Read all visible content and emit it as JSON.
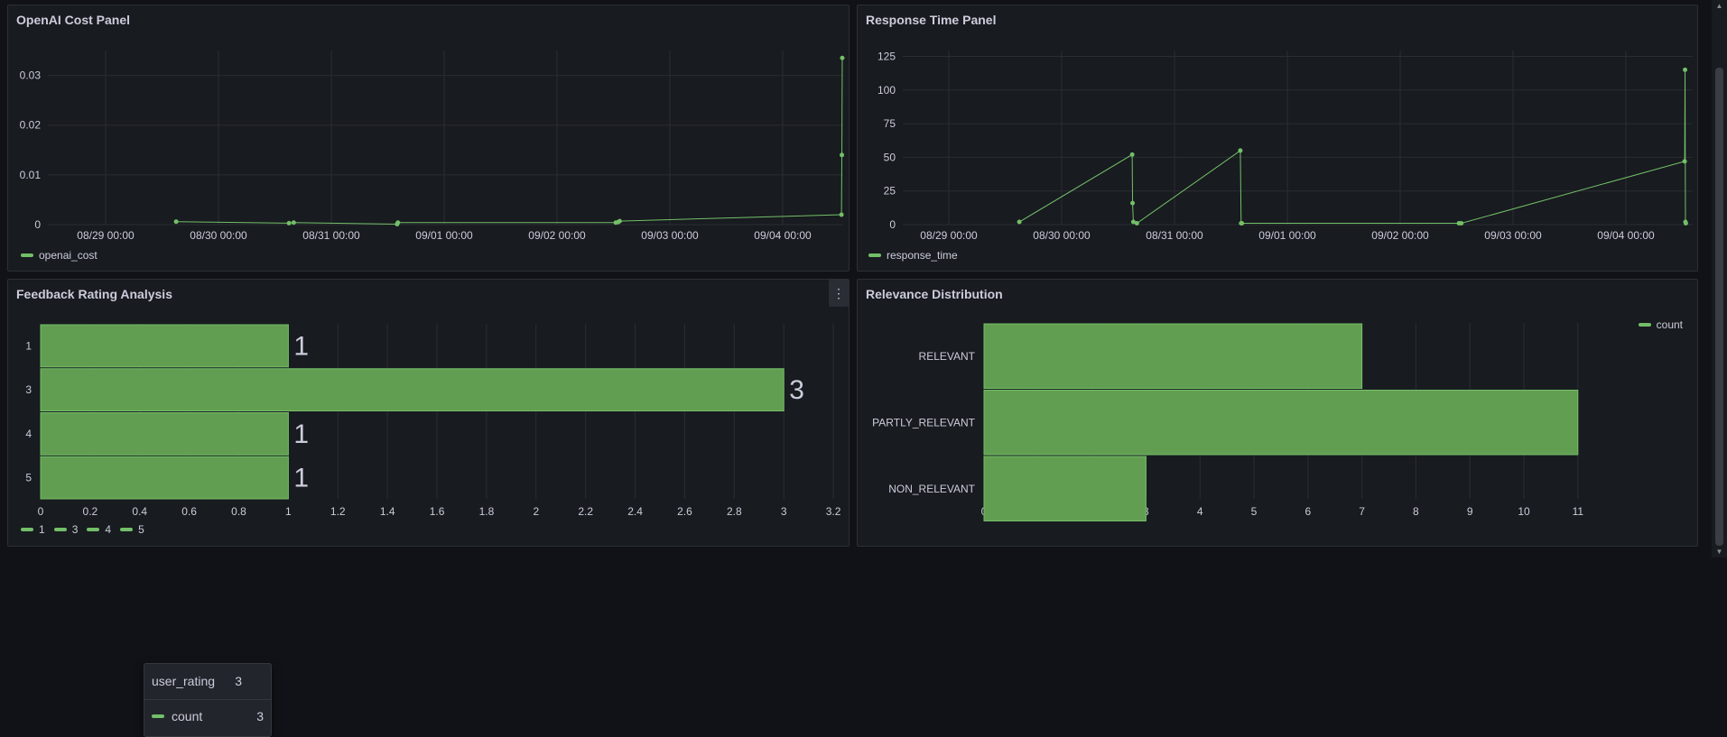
{
  "colors": {
    "series": "#73bf69",
    "bar": "#629e51",
    "bar_edge": "#73bf69"
  },
  "panels": {
    "cost": {
      "title": "OpenAI Cost Panel",
      "legend": [
        "openai_cost"
      ],
      "x_ticks": [
        "08/29 00:00",
        "08/30 00:00",
        "08/31 00:00",
        "09/01 00:00",
        "09/02 00:00",
        "09/03 00:00",
        "09/04 00:00"
      ],
      "y_ticks": [
        "0",
        "0.01",
        "0.02",
        "0.03"
      ]
    },
    "response": {
      "title": "Response Time Panel",
      "legend": [
        "response_time"
      ],
      "x_ticks": [
        "08/29 00:00",
        "08/30 00:00",
        "08/31 00:00",
        "09/01 00:00",
        "09/02 00:00",
        "09/03 00:00",
        "09/04 00:00"
      ],
      "y_ticks": [
        "0",
        "25",
        "50",
        "75",
        "100",
        "125"
      ]
    },
    "feedback": {
      "title": "Feedback Rating Analysis",
      "menu_icon": "⋮",
      "legend": [
        "1",
        "3",
        "4",
        "5"
      ],
      "x_ticks": [
        "0",
        "0.2",
        "0.4",
        "0.6",
        "0.8",
        "1",
        "1.2",
        "1.4",
        "1.6",
        "1.8",
        "2",
        "2.2",
        "2.4",
        "2.6",
        "2.8",
        "3",
        "3.2"
      ],
      "tooltip": {
        "key_label": "user_rating",
        "key_value": "3",
        "series_label": "count",
        "series_value": "3"
      }
    },
    "relevance": {
      "title": "Relevance Distribution",
      "legend": [
        "count"
      ],
      "x_ticks": [
        "0",
        "1",
        "2",
        "3",
        "4",
        "5",
        "6",
        "7",
        "8",
        "9",
        "10",
        "11"
      ]
    }
  },
  "chart_data": [
    {
      "type": "line",
      "title": "OpenAI Cost Panel",
      "series": [
        {
          "name": "openai_cost",
          "x": [
            "08/29 15:00",
            "08/30 15:00",
            "08/30 16:00",
            "08/31 14:00",
            "08/31 14:10",
            "09/02 12:30",
            "09/02 13:00",
            "09/02 13:20",
            "09/04 12:30",
            "09/04 12:35",
            "09/04 12:40"
          ],
          "y": [
            0.0006,
            0.0003,
            0.0004,
            0.0001,
            0.0004,
            0.0004,
            0.0005,
            0.0007,
            0.002,
            0.014,
            0.0335
          ]
        }
      ],
      "ylim": [
        0,
        0.035
      ],
      "legend_position": "bottom-left"
    },
    {
      "type": "line",
      "title": "Response Time Panel",
      "series": [
        {
          "name": "response_time",
          "x": [
            "08/29 15:00",
            "08/30 15:00",
            "08/30 15:05",
            "08/30 15:15",
            "08/30 16:00",
            "08/31 14:00",
            "08/31 14:10",
            "08/31 14:20",
            "09/02 12:30",
            "09/02 13:00",
            "09/04 12:30",
            "09/04 12:35",
            "09/04 12:40",
            "09/04 12:45"
          ],
          "y": [
            2,
            52,
            16,
            2,
            1,
            55,
            1,
            1,
            1,
            1,
            47,
            115,
            2,
            1
          ]
        }
      ],
      "ylim": [
        0,
        130
      ],
      "legend_position": "bottom-left"
    },
    {
      "type": "bar",
      "title": "Feedback Rating Analysis",
      "orientation": "horizontal",
      "categories": [
        "1",
        "3",
        "4",
        "5"
      ],
      "values": [
        1,
        3,
        1,
        1
      ],
      "xlim": [
        0,
        3.2
      ],
      "legend_position": "bottom-left"
    },
    {
      "type": "bar",
      "title": "Relevance Distribution",
      "orientation": "horizontal",
      "categories": [
        "RELEVANT",
        "PARTLY_RELEVANT",
        "NON_RELEVANT"
      ],
      "series": [
        {
          "name": "count",
          "values": [
            7,
            11,
            3
          ]
        }
      ],
      "xlim": [
        0,
        11.5
      ],
      "legend_position": "top-right"
    }
  ]
}
